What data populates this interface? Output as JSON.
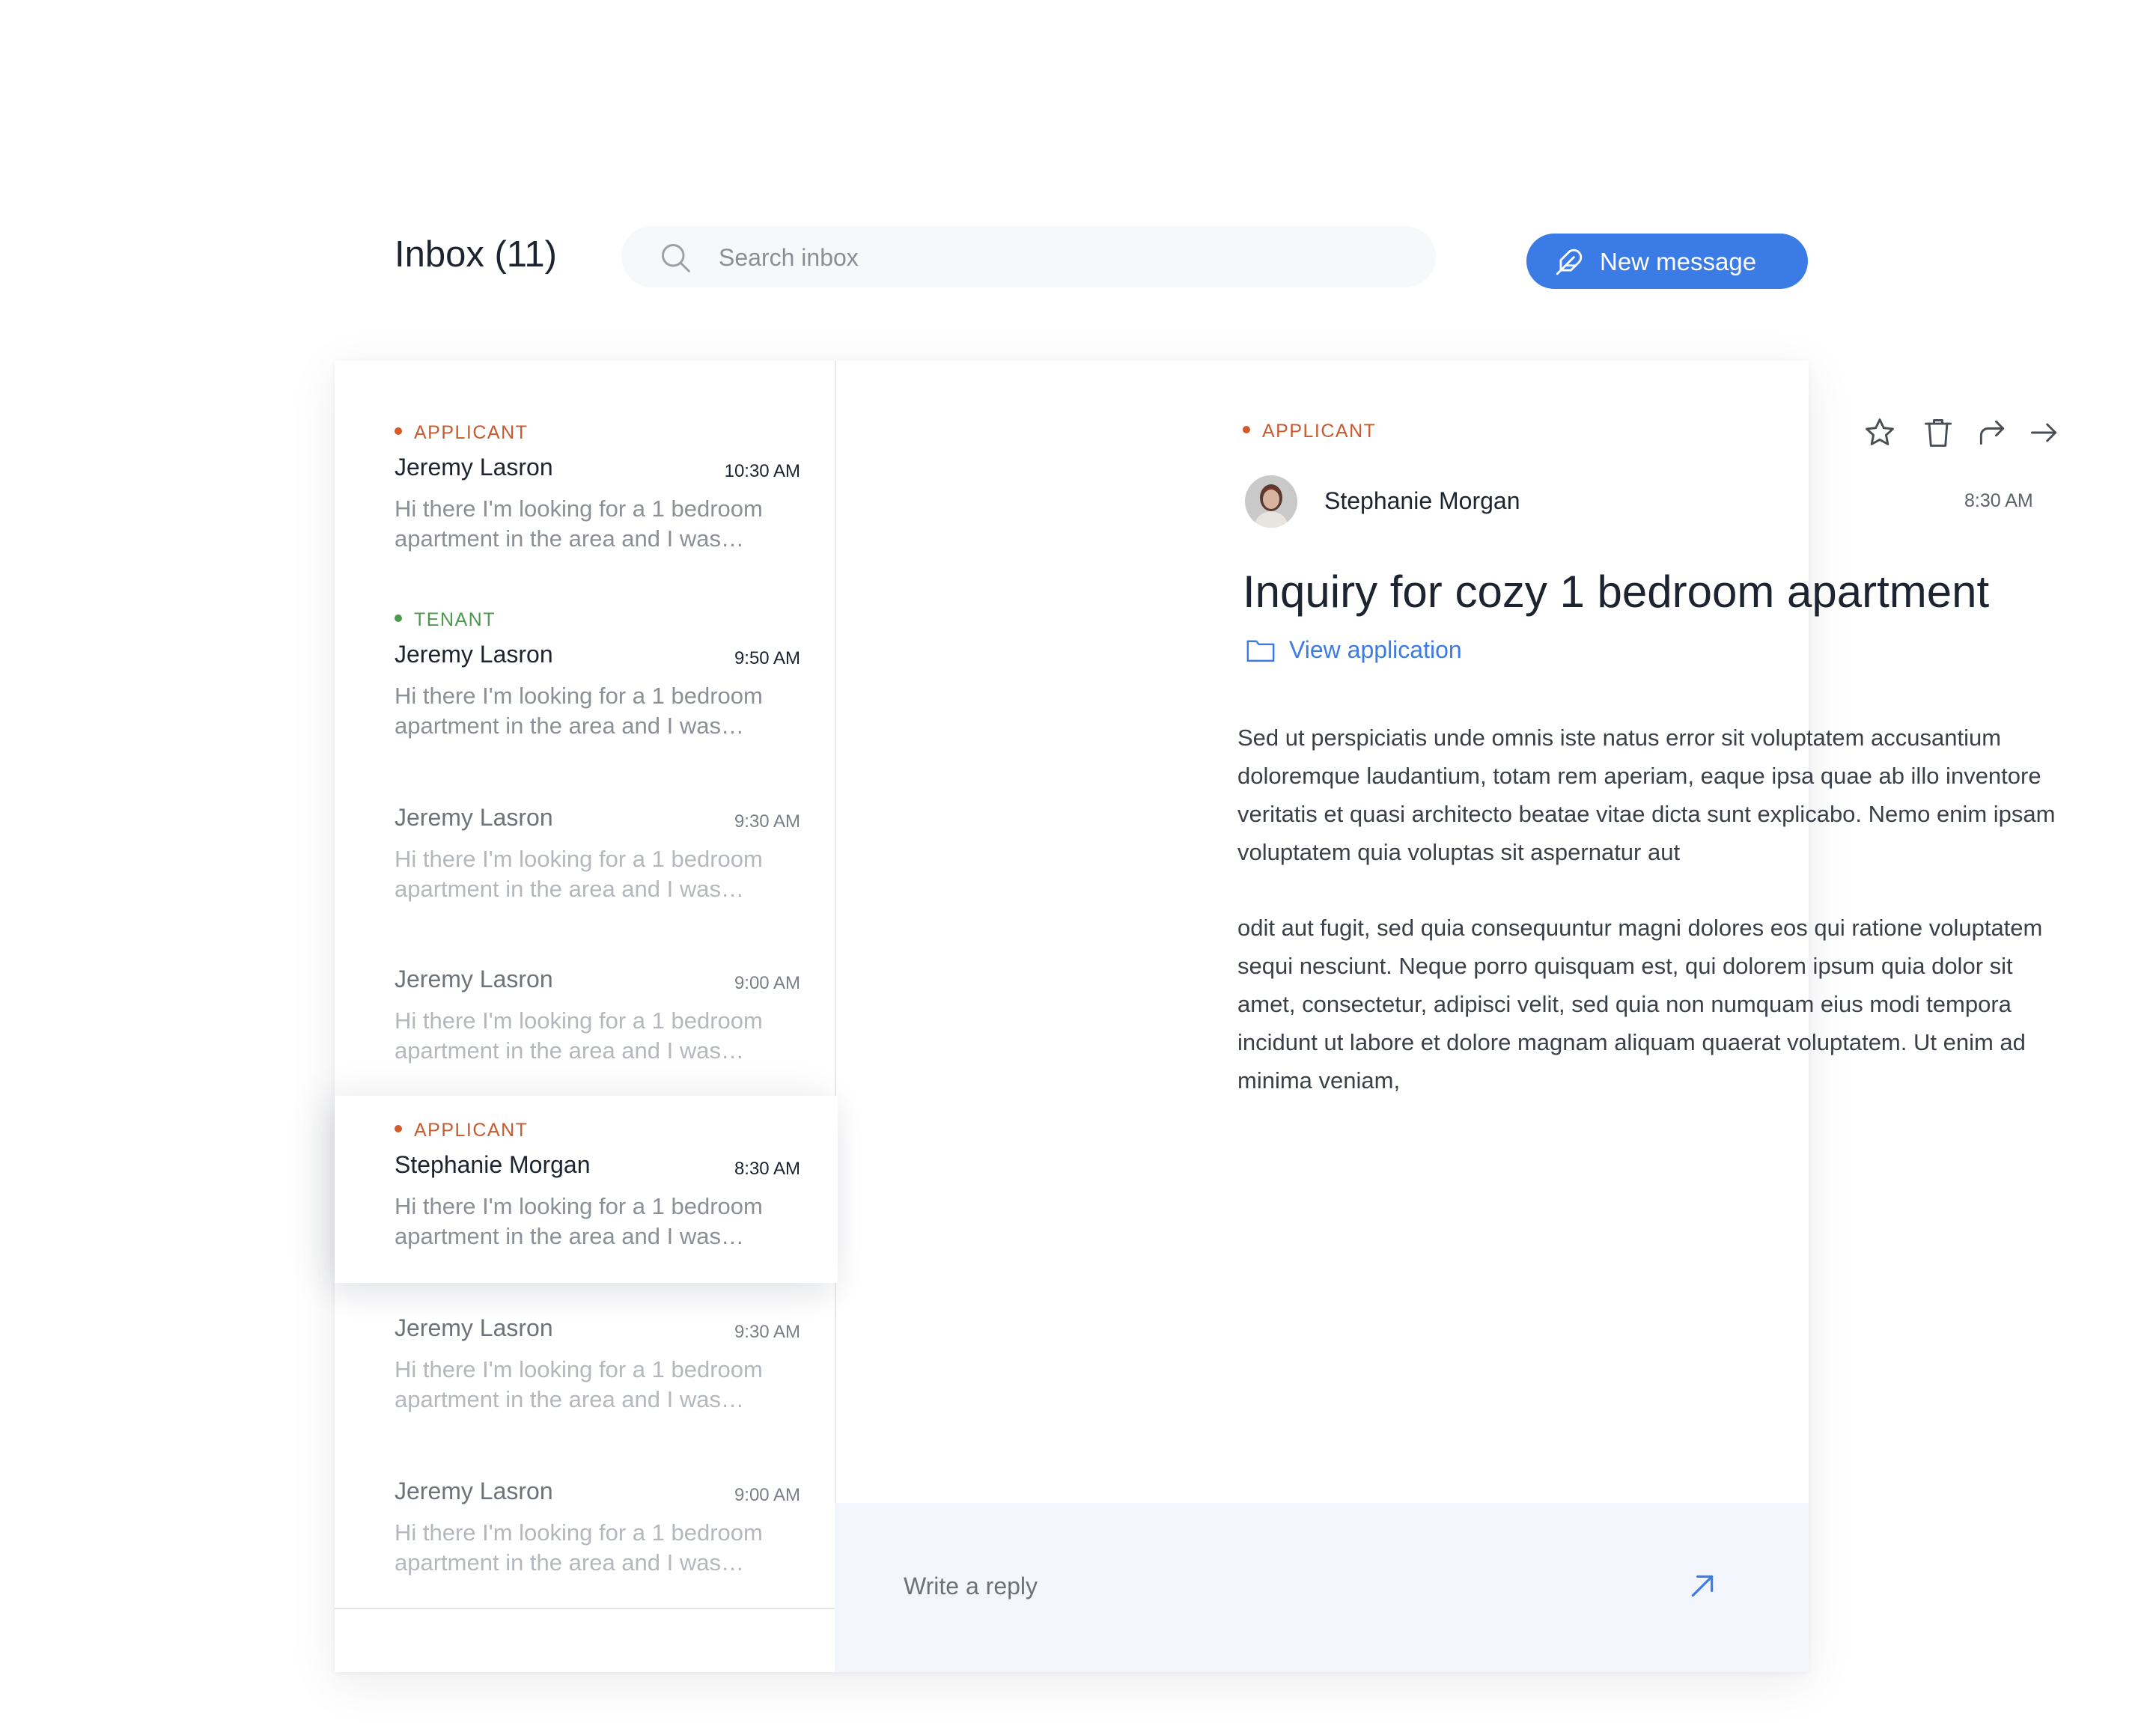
{
  "header": {
    "title": "Inbox (11)",
    "search_placeholder": "Search inbox",
    "new_message_label": "New message",
    "new_message_icon": "feather-icon"
  },
  "colors": {
    "accent": "#3b7be6",
    "applicant": "#c85a2e",
    "tenant": "#4b9a4b",
    "reply_bg": "#f3f7fd"
  },
  "messages": [
    {
      "tag": "APPLICANT",
      "sender": "Jeremy Lasron",
      "time": "10:30 AM",
      "preview": "Hi there I'm looking  for a 1 bedroom apartment in the area and I was…",
      "unread": true
    },
    {
      "tag": "TENANT",
      "sender": "Jeremy Lasron",
      "time": "9:50 AM",
      "preview": "Hi there I'm looking  for a 1 bedroom apartment in the area and I was…",
      "unread": true
    },
    {
      "tag": "",
      "sender": "Jeremy Lasron",
      "time": "9:30 AM",
      "preview": "Hi there I'm looking  for a 1 bedroom apartment in the area and I was…",
      "unread": false
    },
    {
      "tag": "",
      "sender": "Jeremy Lasron",
      "time": "9:00 AM",
      "preview": "Hi there I'm looking  for a 1 bedroom apartment in the area and I was…",
      "unread": false
    },
    {
      "tag": "APPLICANT",
      "sender": "Stephanie Morgan",
      "time": "8:30 AM",
      "preview": "Hi there I'm looking  for a 1 bedroom apartment in the area and I was…",
      "unread": true,
      "selected": true
    },
    {
      "tag": "",
      "sender": "Jeremy Lasron",
      "time": "9:30 AM",
      "preview": "Hi there I'm looking  for a 1 bedroom apartment in the area and I was…",
      "unread": false
    },
    {
      "tag": "",
      "sender": "Jeremy Lasron",
      "time": "9:00 AM",
      "preview": "Hi there I'm looking  for a 1 bedroom apartment in the area and I was…",
      "unread": false
    }
  ],
  "detail": {
    "tag": "APPLICANT",
    "sender": "Stephanie Morgan",
    "time": "8:30 AM",
    "subject": "Inquiry for cozy 1 bedroom apartment",
    "link_label": "View application",
    "actions": [
      "star-icon",
      "trash-icon",
      "forward-icon",
      "arrow-right-icon"
    ],
    "body": [
      "Sed ut perspiciatis unde omnis iste natus error sit voluptatem accusantium doloremque laudantium, totam rem aperiam, eaque ipsa quae ab illo inventore veritatis et quasi architecto beatae vitae dicta sunt explicabo. Nemo enim ipsam voluptatem quia voluptas sit aspernatur aut",
      "odit aut fugit, sed quia consequuntur magni dolores eos qui ratione voluptatem sequi nesciunt. Neque porro quisquam est, qui dolorem ipsum quia dolor sit amet, consectetur, adipisci velit, sed quia non numquam eius modi tempora incidunt ut labore et dolore magnam aliquam quaerat voluptatem. Ut enim ad minima veniam,"
    ],
    "reply_placeholder": "Write a reply"
  }
}
